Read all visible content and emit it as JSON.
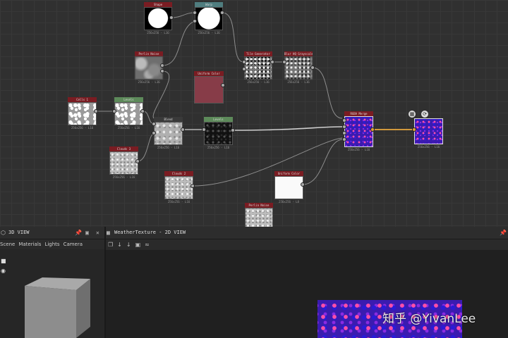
{
  "nodes": [
    {
      "id": "shape",
      "title": "Shape",
      "size": "256x256 - L16",
      "color": "red",
      "tex": "tex-circle"
    },
    {
      "id": "warp",
      "title": "Warp",
      "size": "256x256 - L16",
      "color": "teal",
      "tex": "tex-rounded"
    },
    {
      "id": "perlin1",
      "title": "Perlin Noise",
      "size": "256x256 - L16",
      "color": "red",
      "tex": "tex-blur"
    },
    {
      "id": "tile",
      "title": "Tile Generator",
      "size": "256x256 - L16",
      "color": "red",
      "tex": "tex-bw"
    },
    {
      "id": "blur",
      "title": "Blur HQ Grayscale",
      "size": "256x256 - L16",
      "color": "red",
      "tex": "tex-bw"
    },
    {
      "id": "uniform1",
      "title": "Uniform Color",
      "size": "",
      "color": "red",
      "tex": "tex-maroon"
    },
    {
      "id": "cells",
      "title": "Cells 1",
      "size": "256x256 - L16",
      "color": "red",
      "tex": "tex-cells"
    },
    {
      "id": "levels1",
      "title": "Levels",
      "size": "256x256 - L16",
      "color": "green",
      "tex": "tex-cells"
    },
    {
      "id": "blend",
      "title": "Blend",
      "size": "256x256 - L16",
      "color": "none",
      "tex": "tex-blend"
    },
    {
      "id": "levels2",
      "title": "Levels",
      "size": "256x256 - L16",
      "color": "green",
      "tex": "tex-dark"
    },
    {
      "id": "rgba",
      "title": "RGBA Merge",
      "size": "256x256 - L16",
      "color": "red",
      "tex": "tex-purple"
    },
    {
      "id": "output",
      "title": "",
      "size": "256x256 - L16",
      "color": "none",
      "tex": "tex-purple"
    },
    {
      "id": "clouds3",
      "title": "Clouds 3",
      "size": "256x256 - L16",
      "color": "red",
      "tex": "tex-noise"
    },
    {
      "id": "clouds2",
      "title": "Clouds 2",
      "size": "256x256 - L16",
      "color": "red",
      "tex": "tex-noise"
    },
    {
      "id": "uniform2",
      "title": "Uniform Color",
      "size": "256x256 - L8",
      "color": "red",
      "tex": "tex-white"
    },
    {
      "id": "perlin2",
      "title": "Perlin Noise",
      "size": "",
      "color": "red",
      "tex": "tex-noise"
    }
  ],
  "panel3d": {
    "title": "3D VIEW",
    "menu": [
      "Scene",
      "Materials",
      "Lights",
      "Camera"
    ]
  },
  "panel2d": {
    "title": "WeatherTexture - 2D VIEW",
    "toolbar": [
      "❐",
      "↓",
      "↓",
      "▣",
      "≈"
    ]
  },
  "watermark": "知乎 @YivanLee"
}
